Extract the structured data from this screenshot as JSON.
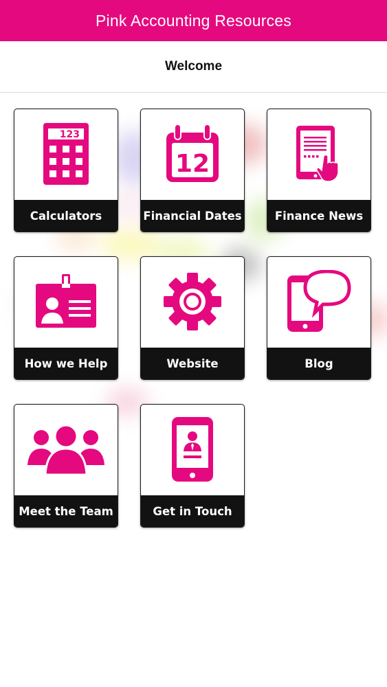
{
  "app": {
    "title": "Pink Accounting Resources",
    "accent_color": "#e5097f"
  },
  "header": {
    "title": "Welcome"
  },
  "tiles": [
    {
      "label": "Calculators",
      "icon": "calculator-icon",
      "icon_text": "123"
    },
    {
      "label": "Financial Dates",
      "icon": "calendar-icon",
      "icon_text": "12"
    },
    {
      "label": "Finance News",
      "icon": "tablet-news-icon"
    },
    {
      "label": "How we Help",
      "icon": "id-badge-icon"
    },
    {
      "label": "Website",
      "icon": "gear-icon"
    },
    {
      "label": "Blog",
      "icon": "phone-chat-icon"
    },
    {
      "label": "Meet the Team",
      "icon": "team-icon"
    },
    {
      "label": "Get in Touch",
      "icon": "phone-contact-icon"
    }
  ]
}
